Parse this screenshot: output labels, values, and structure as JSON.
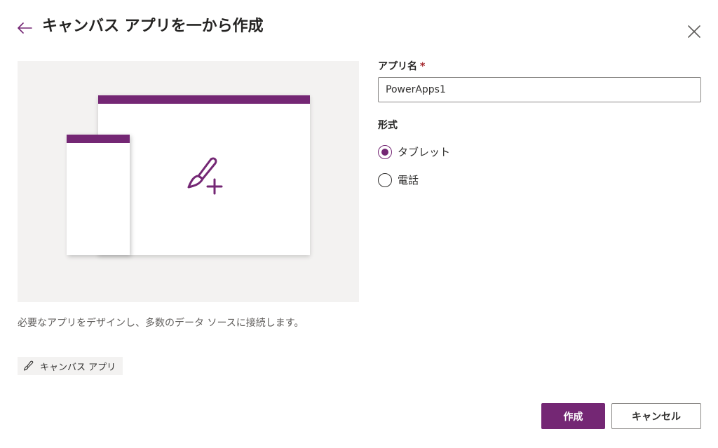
{
  "dialog": {
    "title": "キャンバス アプリを一から作成",
    "back_icon": "arrow-left-icon",
    "close_icon": "close-icon"
  },
  "illustration": {
    "description": "必要なアプリをデザインし、多数のデータ ソースに接続します。",
    "tag_label": "キャンバス アプリ",
    "tag_icon": "paintbrush-icon"
  },
  "form": {
    "app_name_label": "アプリ名",
    "required_mark": "*",
    "app_name_value": "PowerApps1",
    "format_label": "形式",
    "format_options": [
      {
        "label": "タブレット",
        "selected": true
      },
      {
        "label": "電話",
        "selected": false
      }
    ]
  },
  "footer": {
    "create_label": "作成",
    "cancel_label": "キャンセル"
  },
  "colors": {
    "accent": "#742774",
    "illustration_bg": "#f3f2f1",
    "required": "#a4262c"
  }
}
